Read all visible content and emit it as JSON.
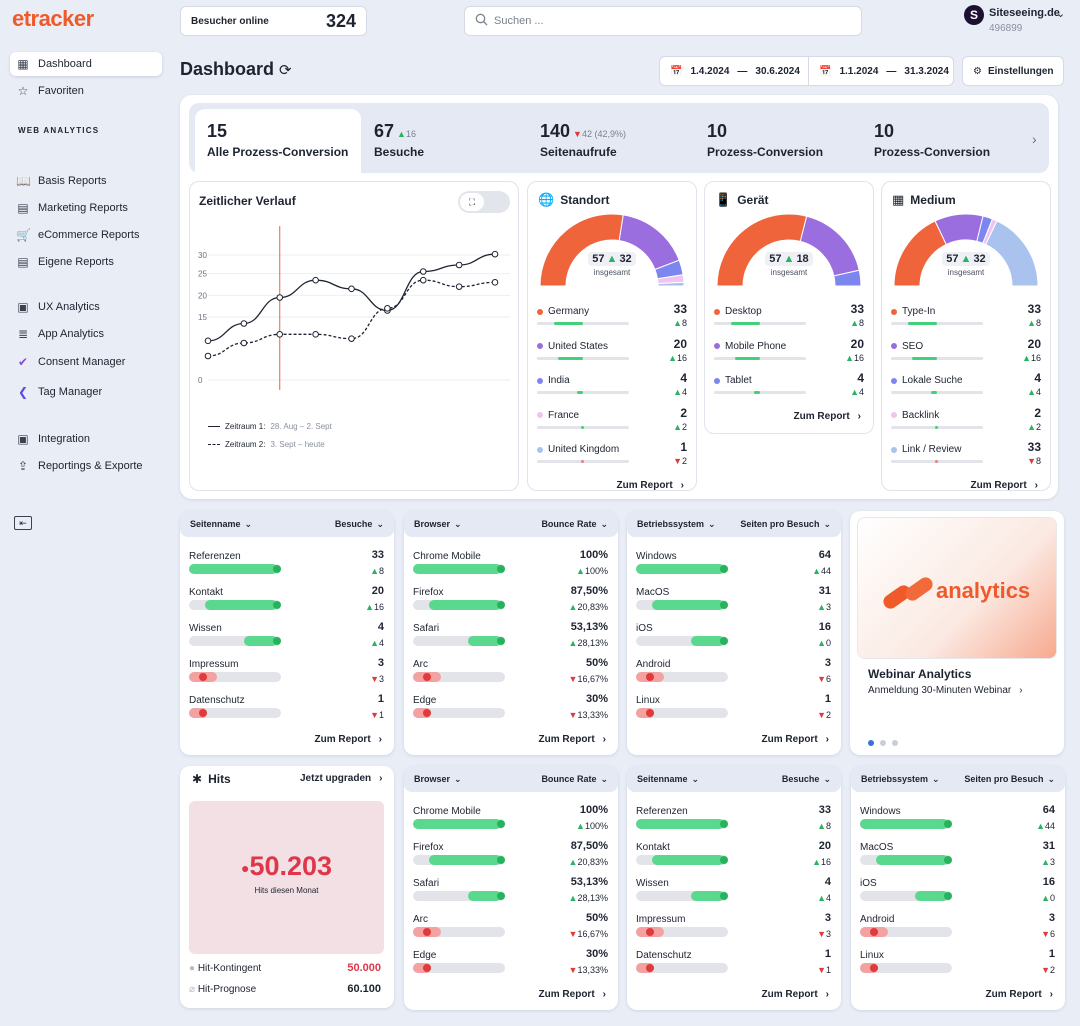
{
  "app": {
    "logo": "etracker"
  },
  "topbar": {
    "visitors_label": "Besucher online",
    "visitors_value": "324",
    "search_placeholder": "Suchen ...",
    "account_name": "Siteseeing.de",
    "account_id": "496899",
    "account_initial": "S"
  },
  "sidebar": {
    "items": [
      {
        "label": "Dashboard",
        "icon": "dashboard-icon"
      },
      {
        "label": "Favoriten",
        "icon": "star-icon"
      },
      {
        "label": "Basis Reports",
        "icon": "book-icon"
      },
      {
        "label": "Marketing Reports",
        "icon": "document-icon"
      },
      {
        "label": "eCommerce Reports",
        "icon": "cart-icon"
      },
      {
        "label": "Eigene Reports",
        "icon": "document-icon"
      },
      {
        "label": "UX Analytics",
        "icon": "ux-icon"
      },
      {
        "label": "App Analytics",
        "icon": "database-icon"
      },
      {
        "label": "Consent Manager",
        "icon": "consent-icon"
      },
      {
        "label": "Tag Manager",
        "icon": "tag-icon"
      },
      {
        "label": "Integration",
        "icon": "integration-icon"
      },
      {
        "label": "Reportings & Exporte",
        "icon": "export-icon"
      }
    ],
    "section_heading": "WEB ANALYTICS"
  },
  "header": {
    "title": "Dashboard",
    "date_range_1_start": "1.4.2024",
    "date_range_1_end": "30.6.2024",
    "date_range_2_start": "1.1.2024",
    "date_range_2_end": "31.3.2024",
    "date_sep": "—",
    "settings_label": "Einstellungen"
  },
  "kpi_tabs": [
    {
      "value": "15",
      "delta": "",
      "name": "Alle Prozess-Conversion"
    },
    {
      "value": "67",
      "delta": "16",
      "delta_dir": "up",
      "name": "Besuche"
    },
    {
      "value": "140",
      "delta": "42 (42,9%)",
      "delta_dir": "down",
      "name": "Seitenaufrufe"
    },
    {
      "value": "10",
      "delta": "",
      "name": "Prozess-Conversion"
    },
    {
      "value": "10",
      "delta": "",
      "name": "Prozess-Conversion"
    }
  ],
  "timeline": {
    "title": "Zeitlicher Verlauf",
    "legend_1_label": "Zeitraum 1:",
    "legend_1_range": "28. Aug – 2. Sept",
    "legend_2_label": "Zeitraum 2:",
    "legend_2_range": "3. Sept – heute"
  },
  "chart_data": {
    "type": "line",
    "yticks": [
      "30",
      "25",
      "20",
      "15",
      "0"
    ],
    "series": [
      {
        "values": [
          9.5,
          13.5,
          19.5,
          23.5,
          21.5,
          16.5,
          25.5,
          27,
          29.5
        ],
        "style": "solid"
      },
      {
        "values": [
          6,
          9,
          11,
          11,
          10,
          17,
          23.5,
          22,
          23
        ],
        "style": "dashed"
      }
    ],
    "marker_index": 2
  },
  "standort": {
    "title": "Standort",
    "center_value": "57",
    "center_delta": "32",
    "center_label": "insgesamt",
    "rows": [
      {
        "name": "Germany",
        "value": "33",
        "delta": "8",
        "dir": "up",
        "color": "#f0643c",
        "pct": 0.62
      },
      {
        "name": "United States",
        "value": "20",
        "delta": "16",
        "dir": "up",
        "color": "#9b6ee0",
        "pct": 0.55
      },
      {
        "name": "India",
        "value": "4",
        "delta": "4",
        "dir": "up",
        "color": "#7d86ef",
        "pct": 0.14
      },
      {
        "name": "France",
        "value": "2",
        "delta": "2",
        "dir": "up",
        "color": "#f0c4ef",
        "pct": 0.05
      },
      {
        "name": "United Kingdom",
        "value": "1",
        "delta": "2",
        "dir": "down",
        "color": "#a9c2ee",
        "pct": 0.04
      }
    ],
    "report_label": "Zum Report"
  },
  "geraet": {
    "title": "Gerät",
    "center_value": "57",
    "center_delta": "18",
    "center_label": "insgesamt",
    "rows": [
      {
        "name": "Desktop",
        "value": "33",
        "delta": "8",
        "dir": "up",
        "color": "#f0643c",
        "pct": 0.62
      },
      {
        "name": "Mobile Phone",
        "value": "20",
        "delta": "16",
        "dir": "up",
        "color": "#9b6ee0",
        "pct": 0.55
      },
      {
        "name": "Tablet",
        "value": "4",
        "delta": "4",
        "dir": "up",
        "color": "#7d86ef",
        "pct": 0.14
      }
    ],
    "report_label": "Zum Report"
  },
  "medium": {
    "title": "Medium",
    "center_value": "57",
    "center_delta": "32",
    "center_label": "insgesamt",
    "rows": [
      {
        "name": "Type-In",
        "value": "33",
        "delta": "8",
        "dir": "up",
        "color": "#f0643c",
        "pct": 0.62
      },
      {
        "name": "SEO",
        "value": "20",
        "delta": "16",
        "dir": "up",
        "color": "#9b6ee0",
        "pct": 0.55
      },
      {
        "name": "Lokale Suche",
        "value": "4",
        "delta": "4",
        "dir": "up",
        "color": "#7d86ef",
        "pct": 0.14
      },
      {
        "name": "Backlink",
        "value": "2",
        "delta": "2",
        "dir": "up",
        "color": "#f0c4ef",
        "pct": 0.05
      },
      {
        "name": "Link / Review",
        "value": "33",
        "delta": "8",
        "dir": "down",
        "color": "#a9c2ee",
        "pct": 0.04
      }
    ],
    "report_label": "Zum Report"
  },
  "cards": {
    "seiten": {
      "col1": "Seitenname",
      "col2": "Besuche",
      "report_label": "Zum Report",
      "rows": [
        {
          "name": "Referenzen",
          "value": "33",
          "delta": "8",
          "dir": "up",
          "pct": 0.96
        },
        {
          "name": "Kontakt",
          "value": "20",
          "delta": "16",
          "dir": "up",
          "pct": 0.78
        },
        {
          "name": "Wissen",
          "value": "4",
          "delta": "4",
          "dir": "up",
          "pct": 0.36
        },
        {
          "name": "Impressum",
          "value": "3",
          "delta": "3",
          "dir": "down",
          "pct": 0.3
        },
        {
          "name": "Datenschutz",
          "value": "1",
          "delta": "1",
          "dir": "down",
          "pct": 0.2
        }
      ]
    },
    "browser": {
      "col1": "Browser",
      "col2": "Bounce Rate",
      "report_label": "Zum Report",
      "rows": [
        {
          "name": "Chrome Mobile",
          "value": "100%",
          "delta": "100%",
          "dir": "up",
          "pct": 0.96
        },
        {
          "name": "Firefox",
          "value": "87,50%",
          "delta": "20,83%",
          "dir": "up",
          "pct": 0.78
        },
        {
          "name": "Safari",
          "value": "53,13%",
          "delta": "28,13%",
          "dir": "up",
          "pct": 0.36
        },
        {
          "name": "Arc",
          "value": "50%",
          "delta": "16,67%",
          "dir": "down",
          "pct": 0.3
        },
        {
          "name": "Edge",
          "value": "30%",
          "delta": "13,33%",
          "dir": "down",
          "pct": 0.2
        }
      ]
    },
    "os": {
      "col1": "Betriebssystem",
      "col2": "Seiten pro Besuch",
      "report_label": "Zum Report",
      "rows": [
        {
          "name": "Windows",
          "value": "64",
          "delta": "44",
          "dir": "up",
          "pct": 0.96
        },
        {
          "name": "MacOS",
          "value": "31",
          "delta": "3",
          "dir": "up",
          "pct": 0.78
        },
        {
          "name": "iOS",
          "value": "16",
          "delta": "0",
          "dir": "up",
          "pct": 0.36
        },
        {
          "name": "Android",
          "value": "3",
          "delta": "6",
          "dir": "down",
          "pct": 0.3
        },
        {
          "name": "Linux",
          "value": "1",
          "delta": "2",
          "dir": "down",
          "pct": 0.2
        }
      ]
    }
  },
  "webinar": {
    "brand_word": "analytics",
    "title": "Webinar Analytics",
    "subtitle": "Anmeldung 30-Minuten Webinar"
  },
  "hits": {
    "title": "Hits",
    "upgrade_label": "Jetzt upgraden",
    "value": "50.203",
    "value_label": "Hits diesen Monat",
    "kontingent_label": "Hit-Kontingent",
    "kontingent_value": "50.000",
    "prognose_label": "Hit-Prognose",
    "prognose_value": "60.100"
  },
  "colors": {
    "accent": "#f05a2a",
    "up": "#28b463",
    "down": "#e03a3a"
  }
}
